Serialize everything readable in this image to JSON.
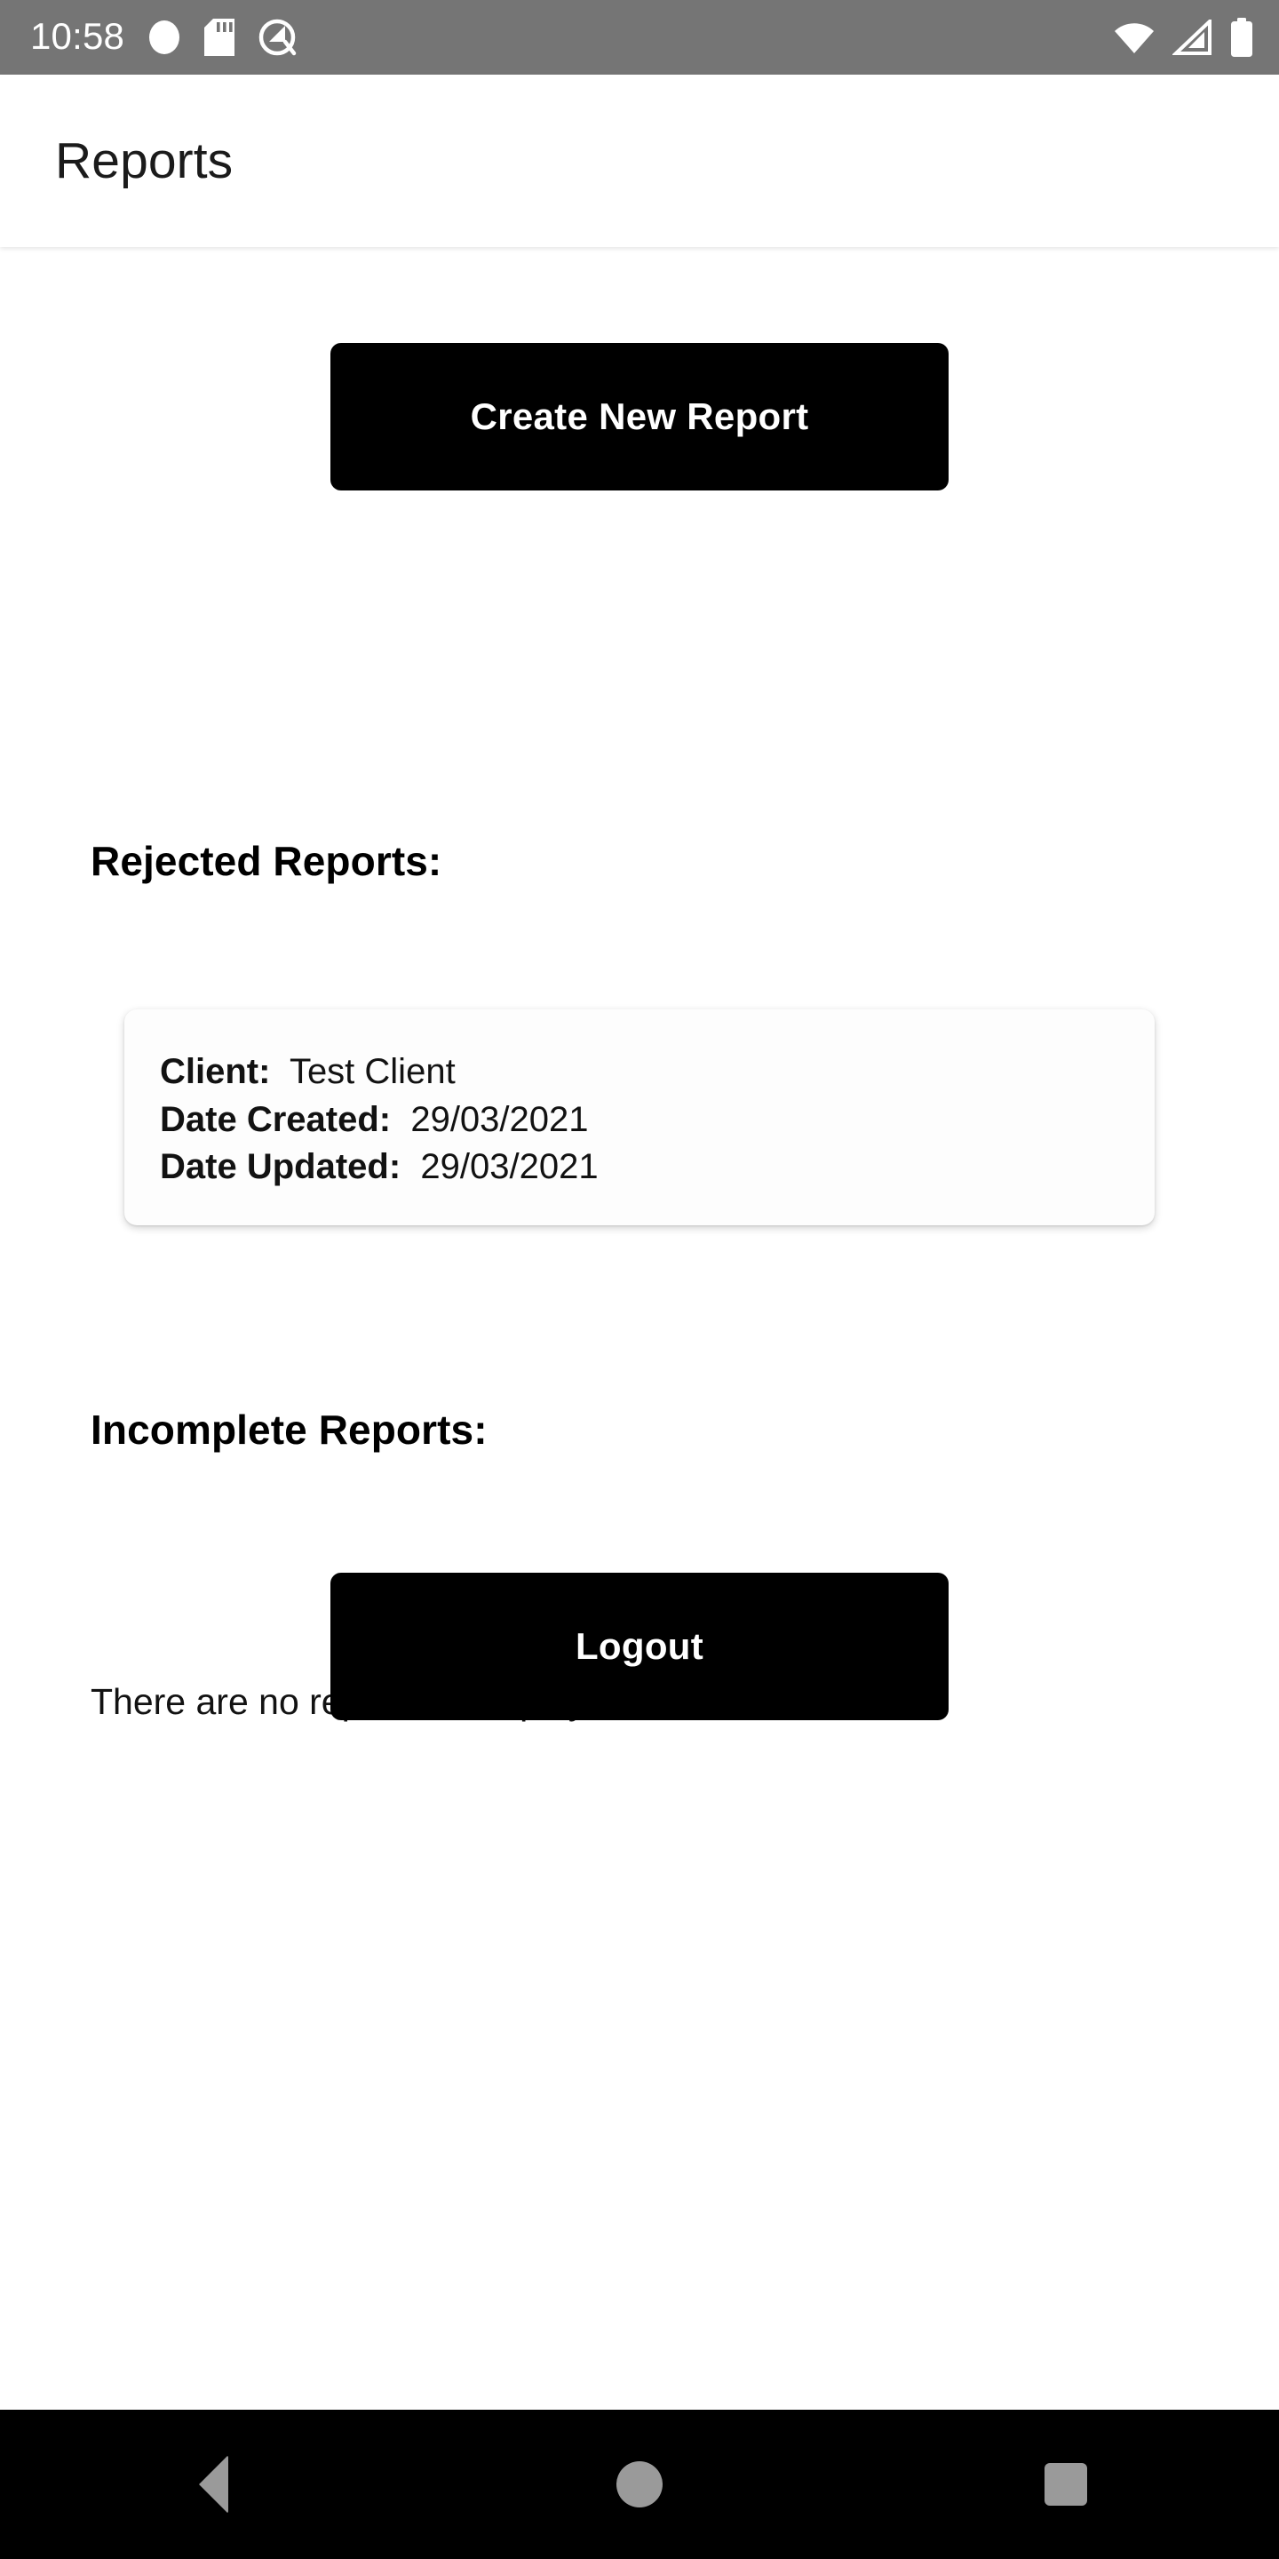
{
  "status_bar": {
    "clock": "10:58",
    "left_icons": [
      "circle-icon",
      "sd-card-icon",
      "data-saver-icon"
    ],
    "right_icons": [
      "wifi-icon",
      "cellular-signal-icon",
      "battery-icon"
    ],
    "background_color": "#757575",
    "foreground_color": "#ffffff"
  },
  "app_bar": {
    "title": "Reports"
  },
  "main": {
    "create_report_label": "Create New Report",
    "rejected_section": {
      "heading": "Rejected Reports:",
      "labels": {
        "client": "Client:",
        "date_created": "Date Created:",
        "date_updated": "Date Updated:"
      },
      "reports": [
        {
          "client": "Test Client",
          "date_created": "29/03/2021",
          "date_updated": "29/03/2021"
        }
      ]
    },
    "incomplete_section": {
      "heading": "Incomplete Reports:",
      "empty_message": "There are no reports to display.",
      "reports": []
    },
    "logout_label": "Logout",
    "button_color": "#000000",
    "button_text_color": "#ffffff",
    "page_background": "#ffffff"
  },
  "nav_bar": {
    "background_color": "#000000",
    "icon_color": "#9a9a9a",
    "buttons": [
      "back-icon",
      "home-icon",
      "recents-icon"
    ]
  }
}
